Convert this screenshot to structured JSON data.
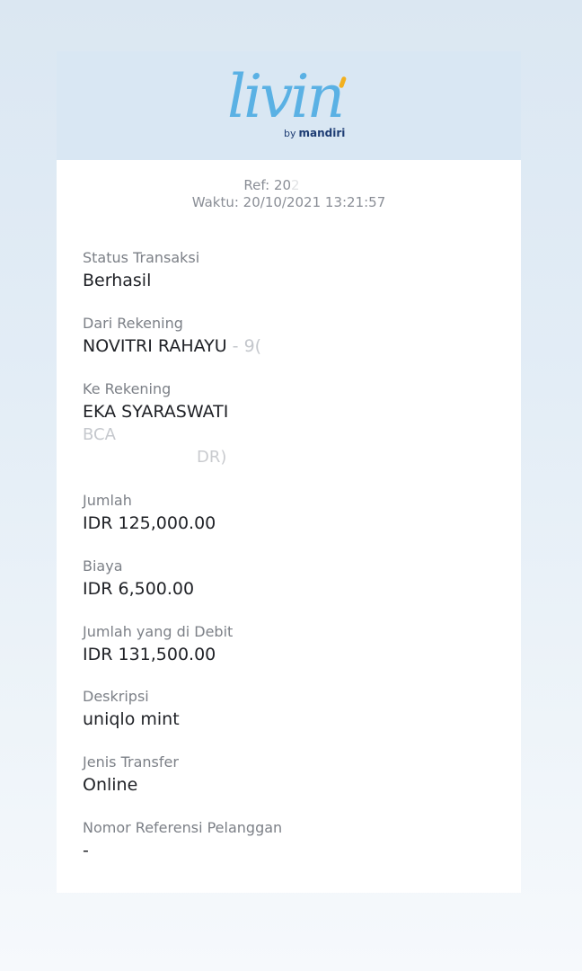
{
  "logo": {
    "word": "livin",
    "by": "by",
    "brand": "mandiri",
    "accent_color": "#f2b01e",
    "word_color": "#5ab1e4"
  },
  "meta": {
    "ref_prefix": "Ref: 20",
    "ref_fade": "2",
    "time": "Waktu: 20/10/2021 13:21:57"
  },
  "fields": {
    "status": {
      "label": "Status Transaksi",
      "value": "Berhasil"
    },
    "from": {
      "label": "Dari Rekening",
      "value": "NOVITRI RAHAYU",
      "account": " - 9("
    },
    "to": {
      "label": "Ke Rekening",
      "value": "EKA SYARASWATI",
      "bank": "BCA",
      "extra": "DR)"
    },
    "amount": {
      "label": "Jumlah",
      "value": "IDR 125,000.00"
    },
    "fee": {
      "label": "Biaya",
      "value": "IDR 6,500.00"
    },
    "debited": {
      "label": "Jumlah yang di Debit",
      "value": "IDR 131,500.00"
    },
    "description": {
      "label": "Deskripsi",
      "value": "uniqlo mint"
    },
    "transfer_type": {
      "label": "Jenis Transfer",
      "value": "Online"
    },
    "customer_ref": {
      "label": "Nomor Referensi Pelanggan",
      "value": "-"
    }
  }
}
